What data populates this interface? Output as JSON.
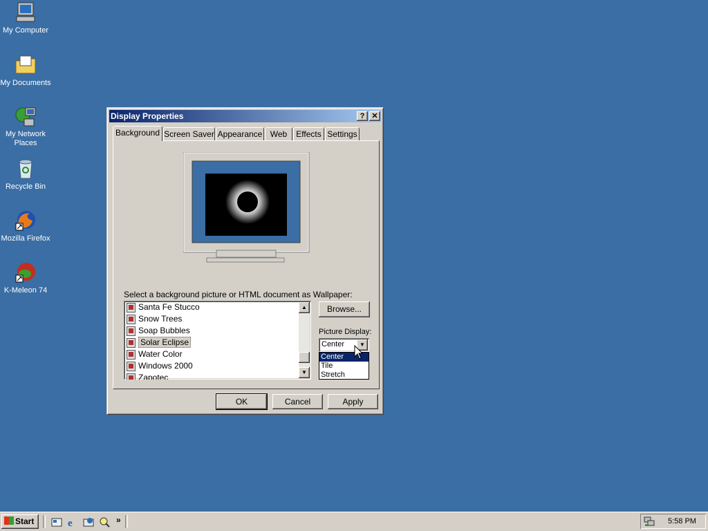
{
  "desktop": {
    "icons": [
      {
        "label": "My Computer",
        "icon": "my-computer-icon"
      },
      {
        "label": "My Documents",
        "icon": "my-documents-icon"
      },
      {
        "label": "My Network Places",
        "icon": "network-places-icon"
      },
      {
        "label": "Recycle Bin",
        "icon": "recycle-bin-icon"
      },
      {
        "label": "Mozilla Firefox",
        "icon": "firefox-icon"
      },
      {
        "label": "K-Meleon 74",
        "icon": "k-meleon-icon"
      }
    ],
    "background_color": "#3a6ea5"
  },
  "dialog": {
    "title": "Display Properties",
    "help_button": "?",
    "close_button": "✕",
    "tabs": [
      "Background",
      "Screen Saver",
      "Appearance",
      "Web",
      "Effects",
      "Settings"
    ],
    "active_tab": "Background",
    "wallpaper_prompt": "Select a background picture or HTML document as Wallpaper:",
    "wallpaper_list": [
      "Santa Fe Stucco",
      "Snow Trees",
      "Soap Bubbles",
      "Solar Eclipse",
      "Water Color",
      "Windows 2000",
      "Zapotec"
    ],
    "selected_wallpaper": "Solar Eclipse",
    "browse_button": "Browse...",
    "picture_display_label": "Picture Display:",
    "picture_display_value": "Center",
    "picture_display_options": [
      "Center",
      "Tile",
      "Stretch"
    ],
    "ok_button": "OK",
    "cancel_button": "Cancel",
    "apply_button": "Apply"
  },
  "taskbar": {
    "start_label": "Start",
    "quick_launch": [
      "show-desktop-icon",
      "internet-explorer-icon",
      "outlook-express-icon",
      "search-icon"
    ],
    "overflow": "»",
    "clock": "5:58 PM"
  }
}
